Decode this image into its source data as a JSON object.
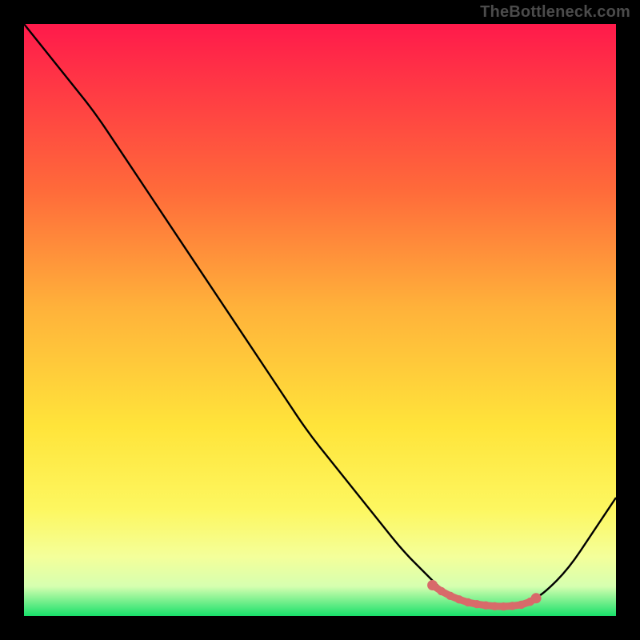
{
  "watermark": "TheBottleneck.com",
  "colors": {
    "black": "#000000",
    "curve": "#000000",
    "dots": "#d86a6a",
    "grad_top": "#ff1a4b",
    "grad_mid1": "#ff6a3a",
    "grad_mid2": "#ffb23a",
    "grad_mid3": "#ffe43a",
    "grad_mid4": "#fdf760",
    "grad_mid5": "#f4ff9a",
    "grad_mid6": "#d6ffb0",
    "grad_bot": "#18e06a"
  },
  "chart_data": {
    "type": "line",
    "title": "",
    "xlabel": "",
    "ylabel": "",
    "xlim": [
      0,
      100
    ],
    "ylim": [
      0,
      100
    ],
    "x": [
      0,
      4,
      8,
      12,
      16,
      20,
      24,
      28,
      32,
      36,
      40,
      44,
      48,
      52,
      56,
      60,
      64,
      68,
      70,
      72,
      74,
      76,
      78,
      80,
      82,
      84,
      86,
      88,
      92,
      96,
      100
    ],
    "y": [
      100,
      95,
      90,
      85,
      79,
      73,
      67,
      61,
      55,
      49,
      43,
      37,
      31,
      26,
      21,
      16,
      11,
      7,
      5,
      3.5,
      2.5,
      2,
      1.7,
      1.6,
      1.7,
      2,
      2.8,
      4,
      8,
      14,
      20
    ],
    "highlight_range_x": [
      69,
      86
    ],
    "highlight_points": {
      "x": [
        69,
        70.5,
        72,
        73.5,
        75,
        76.5,
        78,
        79.5,
        81,
        82.5,
        84,
        85.5,
        86.5
      ],
      "y": [
        5.2,
        4.2,
        3.4,
        2.8,
        2.3,
        2.0,
        1.8,
        1.65,
        1.6,
        1.7,
        1.9,
        2.4,
        3.0
      ]
    }
  }
}
